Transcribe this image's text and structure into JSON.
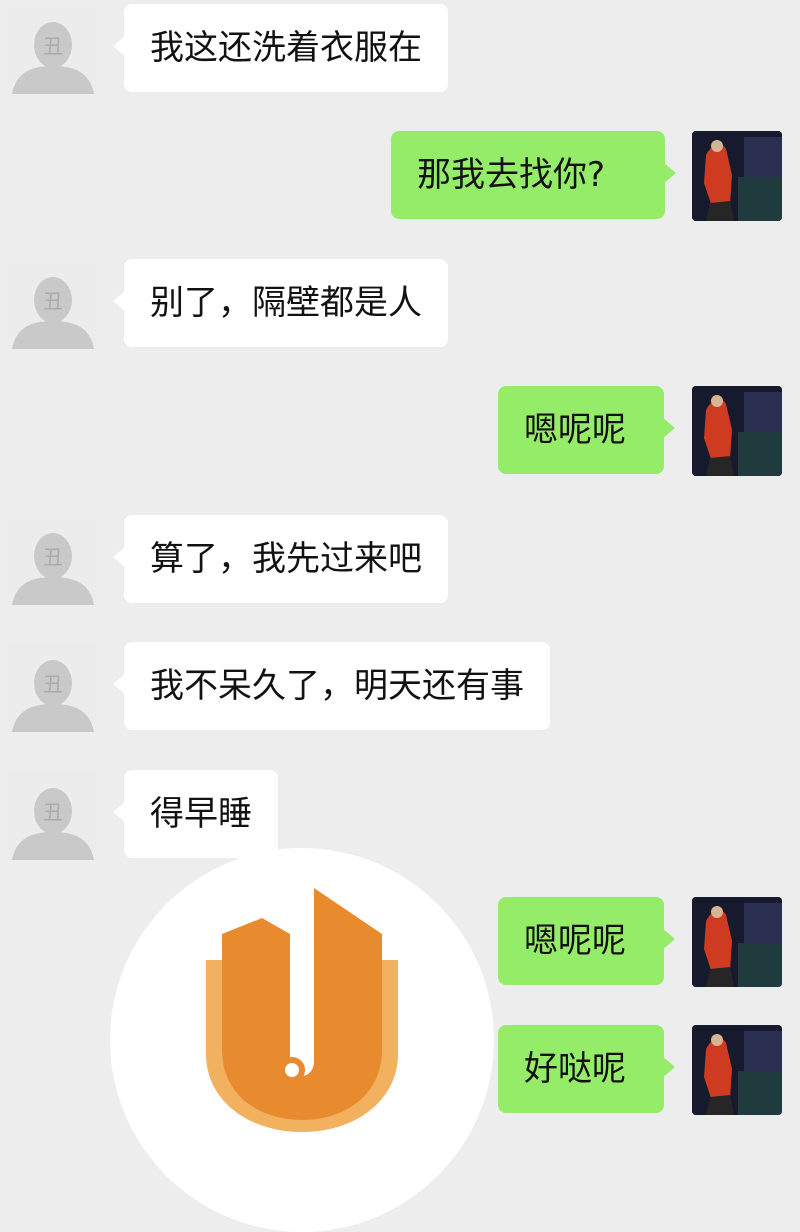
{
  "colors": {
    "background": "#ededed",
    "incoming_bubble": "#ffffff",
    "outgoing_bubble": "#95ec69",
    "text": "#121212",
    "default_avatar": "#c9c9c9",
    "logo_orange": "#e88b2f",
    "logo_light": "#f2b15f"
  },
  "icons": {
    "incoming_avatar": "default-user-avatar-icon",
    "outgoing_avatar": "photo-avatar-icon",
    "watermark": "orange-u-logo-icon"
  },
  "chat": {
    "messages": [
      {
        "side": "incoming",
        "text": "我这还洗着衣服在"
      },
      {
        "side": "outgoing",
        "text": "那我去找你?"
      },
      {
        "side": "incoming",
        "text": "别了，隔壁都是人"
      },
      {
        "side": "outgoing",
        "text": "嗯呢呢"
      },
      {
        "side": "incoming",
        "text": "算了，我先过来吧"
      },
      {
        "side": "incoming",
        "text": "我不呆久了，明天还有事"
      },
      {
        "side": "incoming",
        "text": "得早睡"
      },
      {
        "side": "outgoing",
        "text": "嗯呢呢"
      },
      {
        "side": "outgoing",
        "text": "好哒呢"
      }
    ]
  }
}
